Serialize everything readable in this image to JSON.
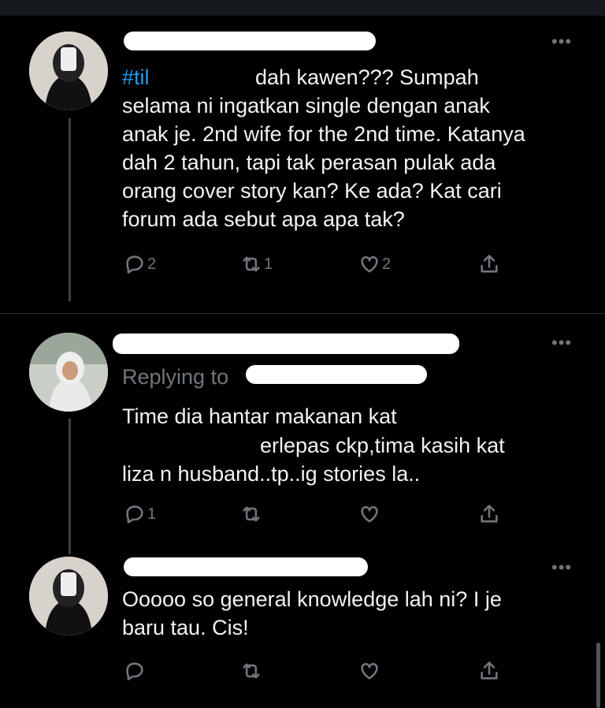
{
  "tweets": [
    {
      "hashtag": "#til",
      "line1": "dah kawen??? Sumpah",
      "line2": "selama ni ingatkan single dengan anak",
      "line3": "anak je. 2nd wife for the 2nd time. Katanya",
      "line4": "dah 2 tahun, tapi tak perasan pulak ada",
      "line5": "orang cover story kan? Ke ada? Kat cari",
      "line6": "forum ada sebut apa apa tak?",
      "reply_count": "2",
      "retweet_count": "1",
      "like_count": "2"
    },
    {
      "replying_to": "Replying to",
      "line1": "Time dia hantar makanan kat",
      "line2": "erlepas ckp,tima kasih kat",
      "line3": "liza n husband..tp..ig stories la..",
      "reply_count": "1"
    },
    {
      "line1": "Ooooo so general knowledge lah ni? I je",
      "line2": "baru tau. Cis!"
    }
  ],
  "icons": [
    "reply-icon",
    "retweet-icon",
    "like-icon",
    "share-icon",
    "more-icon"
  ],
  "colors": {
    "background": "#000000",
    "accent": "#1d9bf0",
    "muted": "#71767b"
  }
}
